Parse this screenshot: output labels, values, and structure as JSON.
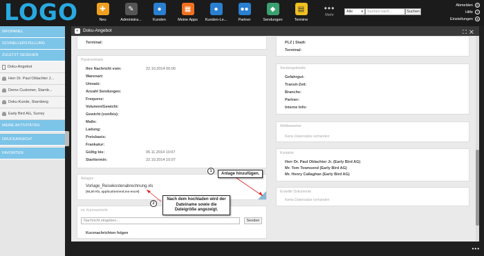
{
  "app": {
    "logo": "LOGO"
  },
  "nav": [
    {
      "label": "Neu",
      "icon": "new-icon",
      "color": "#f0a020"
    },
    {
      "label": "Administra...",
      "icon": "tools-icon",
      "color": "#555555"
    },
    {
      "label": "Kunden",
      "icon": "customers-icon",
      "color": "#2a7fd0"
    },
    {
      "label": "Meine Apps",
      "icon": "apps-icon",
      "color": "#f07020"
    },
    {
      "label": "Kunden-Le...",
      "icon": "customer-life-icon",
      "color": "#2a7fd0"
    },
    {
      "label": "Partner",
      "icon": "partner-icon",
      "color": "#2a7fd0"
    },
    {
      "label": "Sendungen",
      "icon": "shipments-icon",
      "color": "#3aa070"
    },
    {
      "label": "Termine",
      "icon": "appointments-icon",
      "color": "#f0c020"
    }
  ],
  "nav_more": {
    "dots": "•••",
    "label": "Mehr"
  },
  "search": {
    "scope": "Alle",
    "placeholder": "Suchen nach...",
    "button": "Suchen"
  },
  "user_links": {
    "logout": "Abmelden",
    "help": "Hilfe",
    "settings": "Einstellungen"
  },
  "sidebar": {
    "infopanel": "INFOPANEL",
    "quick_create": "SCHNELLERSTELLUNG",
    "recent": "ZULETZT GESEHEN",
    "recent_items": [
      {
        "label": "Doku-Angebot",
        "icon": "doc"
      },
      {
        "label": "Herr Dr. Paul Oblachter J...",
        "icon": "pers"
      },
      {
        "label": "Demo Customer, Starnb...",
        "icon": "pers"
      },
      {
        "label": "Doku-Kunde, Starnberg",
        "icon": "pers"
      },
      {
        "label": "Early Bird AG, Surrey",
        "icon": "pers"
      }
    ],
    "my_activities": "MEINE AKTIVITÄTEN",
    "print_view": "DRUCKANSICHT",
    "favorites": "FAVORITEN"
  },
  "main": {
    "title": "Doku-Angebot",
    "left_top": {
      "terminal": "Terminal:"
    },
    "right_top": {
      "plz": "PLZ | Stadt:",
      "terminal": "Terminal:"
    },
    "pipeline": {
      "title": "Pipelinedetails",
      "rows": [
        {
          "label": "Ihre Nachricht vom:",
          "value": "22.10.2014 00:00"
        },
        {
          "label": "Warenart:",
          "value": ""
        },
        {
          "label": "Umsatz:",
          "value": ""
        },
        {
          "label": "Anzahl Sendungen:",
          "value": ""
        },
        {
          "label": "Frequenz:",
          "value": ""
        },
        {
          "label": "Volumen/Gewicht:",
          "value": ""
        },
        {
          "label": "Gewicht (von/bis):",
          "value": ""
        },
        {
          "label": "Maße:",
          "value": ""
        },
        {
          "label": "Ladung:",
          "value": ""
        },
        {
          "label": "Preisbasis:",
          "value": ""
        },
        {
          "label": "Frankatur:",
          "value": ""
        },
        {
          "label": "Gültig bis:",
          "value": "05.11.2014 10:07"
        },
        {
          "label": "Starttermin:",
          "value": "22.10.2014 10:07"
        }
      ]
    },
    "shipment": {
      "title": "Sendungsdetails",
      "rows": [
        "Gefahrgut:",
        "Transit-Zeit:",
        "Branche:",
        "Partner:",
        "Interne Info:"
      ]
    },
    "competitors": {
      "title": "Wettbewerber",
      "empty": "Keine Datensätze vorhanden"
    },
    "contacts": {
      "title": "Kontakte",
      "items": [
        "Herr Dr. Paul Oblachter Jr. (Early Bird AG)",
        "Mr. Tom Townsend (Early Bird AG)",
        "Mr. Henry Callaghan (Early Bird AG)"
      ]
    },
    "created_docs": {
      "title": "Erstellte Dokumente",
      "empty": "Keine Datensätze vorhanden"
    },
    "attachments": {
      "title": "Anlagen",
      "file_name": "Vorlage_Reisekostenabrechnung.xls",
      "file_meta": "(94,00 Kb, application/vnd.ms-excel)"
    },
    "messages": {
      "title": "int. Kurznachricht",
      "placeholder": "Nachricht eingeben...",
      "send": "Senden",
      "follow": "Kurznachrichten folgen"
    }
  },
  "callouts": {
    "one_num": "1",
    "one_text": "Anlage hinzufügen.",
    "two_num": "2",
    "two_text": "Nach dem hochladen wird der Dateiname sowie die Dateigröße angezeigt."
  },
  "footer": {
    "dots": "•••"
  }
}
